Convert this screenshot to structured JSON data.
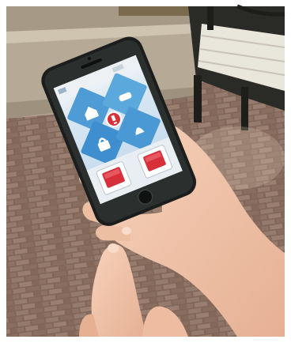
{
  "scene": {
    "subject": "hand-holding-smartphone",
    "setting": "outdoor-brick-plaza",
    "colors": {
      "frame": "#ffffff",
      "brick_light": "#9a7e70",
      "brick_dark": "#6c5248",
      "phone_body": "#1b1e1d",
      "screen_blue": "#3a8fd0",
      "screen_tile": "#5aa8dc",
      "accent_red": "#d8303a",
      "skin": "#f0c4aa",
      "bench_wood": "#e8e4d8",
      "planter_stone": "#b8ad9b"
    }
  },
  "phone_app": {
    "tiles": [
      {
        "icon": "home-icon"
      },
      {
        "icon": "car-icon"
      },
      {
        "icon": "lock-icon"
      },
      {
        "icon": "bell-icon"
      }
    ],
    "center_badge_icon": "alarm-icon",
    "bottom_buttons": [
      {
        "icon": "red-square-button-icon"
      },
      {
        "icon": "red-square-button-icon"
      }
    ]
  }
}
